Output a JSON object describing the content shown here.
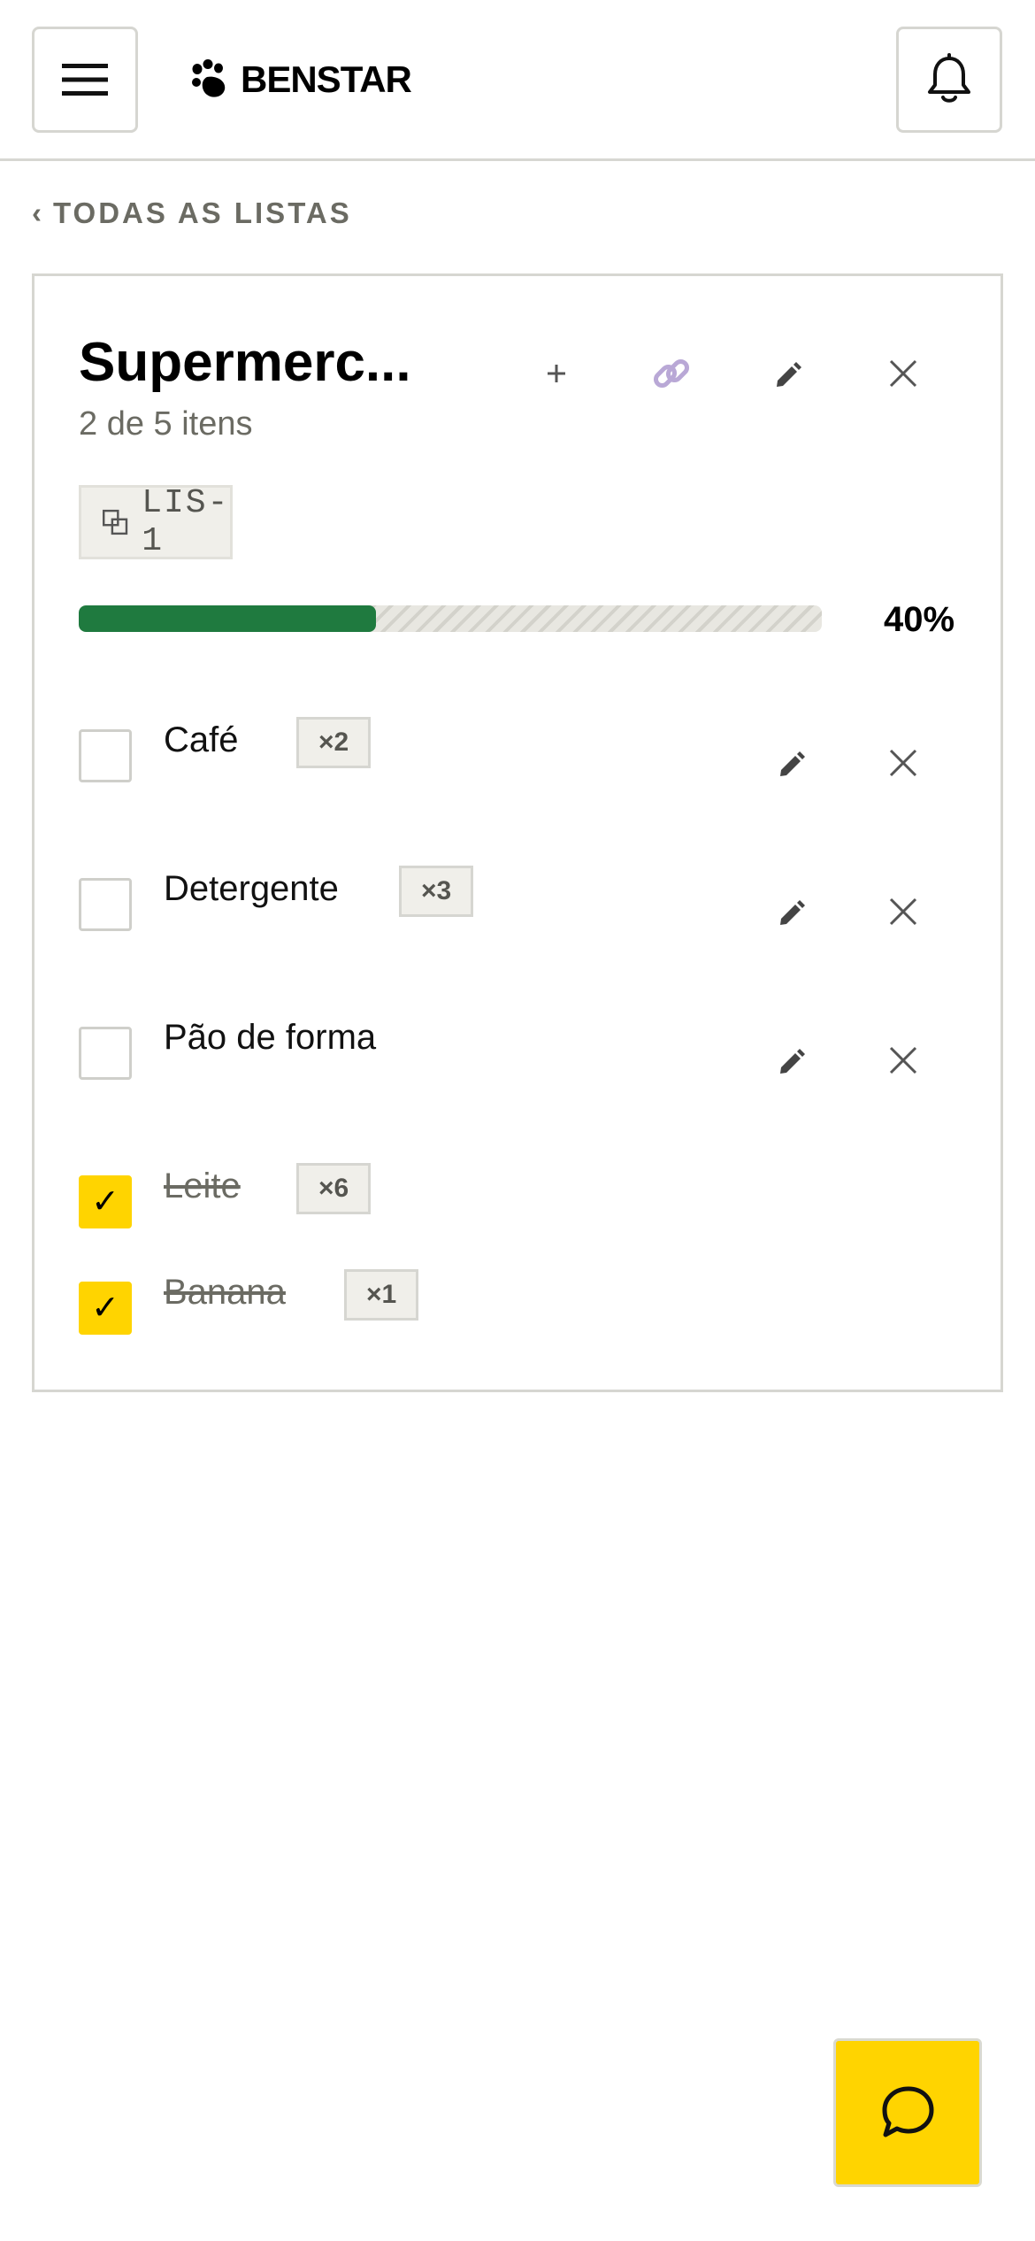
{
  "header": {
    "brand_name": "BENSTAR",
    "menu_icon": "hamburger-menu-icon",
    "notification_icon": "bell-icon"
  },
  "breadcrumb": {
    "back_label": "TODAS AS LISTAS"
  },
  "list": {
    "title": "Supermerc...",
    "count_text": "2 de 5 itens",
    "tag": "LIS-1",
    "progress": {
      "value": 0.4,
      "label": "40%"
    },
    "actions": [
      "add-icon",
      "link-icon",
      "pencil-icon",
      "close-icon"
    ],
    "items": [
      {
        "label": "Café",
        "qty": "×2",
        "checked": false
      },
      {
        "label": "Detergente",
        "qty": "×3",
        "checked": false
      },
      {
        "label": "Pão de forma",
        "qty": "",
        "checked": false
      },
      {
        "label": "Leite",
        "qty": "×6",
        "checked": true
      },
      {
        "label": "Banana",
        "qty": "×1",
        "checked": true
      }
    ]
  },
  "colors": {
    "accent": "#ffd400",
    "progress": "#1f7a3f",
    "muted": "#6b6b63"
  }
}
